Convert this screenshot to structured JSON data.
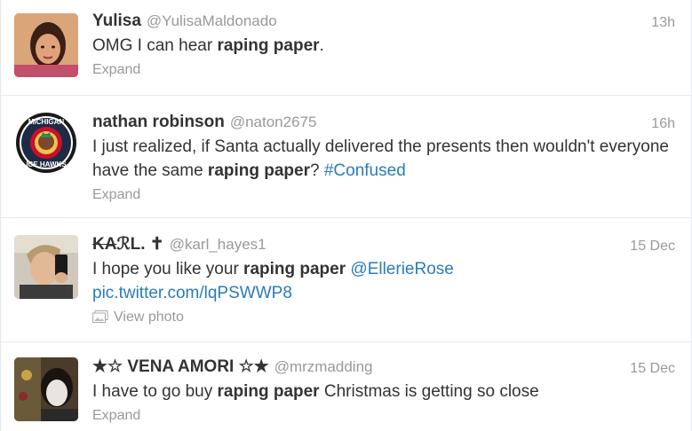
{
  "tweets": [
    {
      "fullname": "⁣Yulisa⁣",
      "screenname": "@YulisaMaldonado",
      "time": "13h",
      "text_before": "OMG I can hear ",
      "bold": "raping paper",
      "text_after": ".",
      "footer": "Expand"
    },
    {
      "fullname": "nathan robinson",
      "screenname": "@naton2675",
      "time": "16h",
      "text_before": "I just realized, if Santa actually delivered the presents then wouldn't everyone have the same ",
      "bold": "raping paper",
      "text_after": "? ",
      "hashtag": "#Confused",
      "footer": "Expand",
      "avatar_text": "MICHIGAN ICE HAWKS"
    },
    {
      "fullname_strike": "KA",
      "fullname_rest": "ℛL. ✝",
      "screenname": "@karl_hayes1",
      "time": "15 Dec",
      "text_before": "I hope you like your ",
      "bold": "raping paper",
      "mention": "@EllerieRose",
      "piclink": "pic.twitter.com/lqPSWWP8",
      "footer": "View photo"
    },
    {
      "fullname": "★☆ VENA AMORI ☆★",
      "screenname": "@mrzmadding",
      "time": "15 Dec",
      "text_before": "I have to go buy ",
      "bold": "raping paper",
      "text_after": " Christmas is getting so close",
      "footer": "Expand"
    }
  ],
  "colors": {
    "text": "#333333",
    "muted": "#999999",
    "link": "#2b7bb9",
    "divider": "#e8e8e8"
  }
}
